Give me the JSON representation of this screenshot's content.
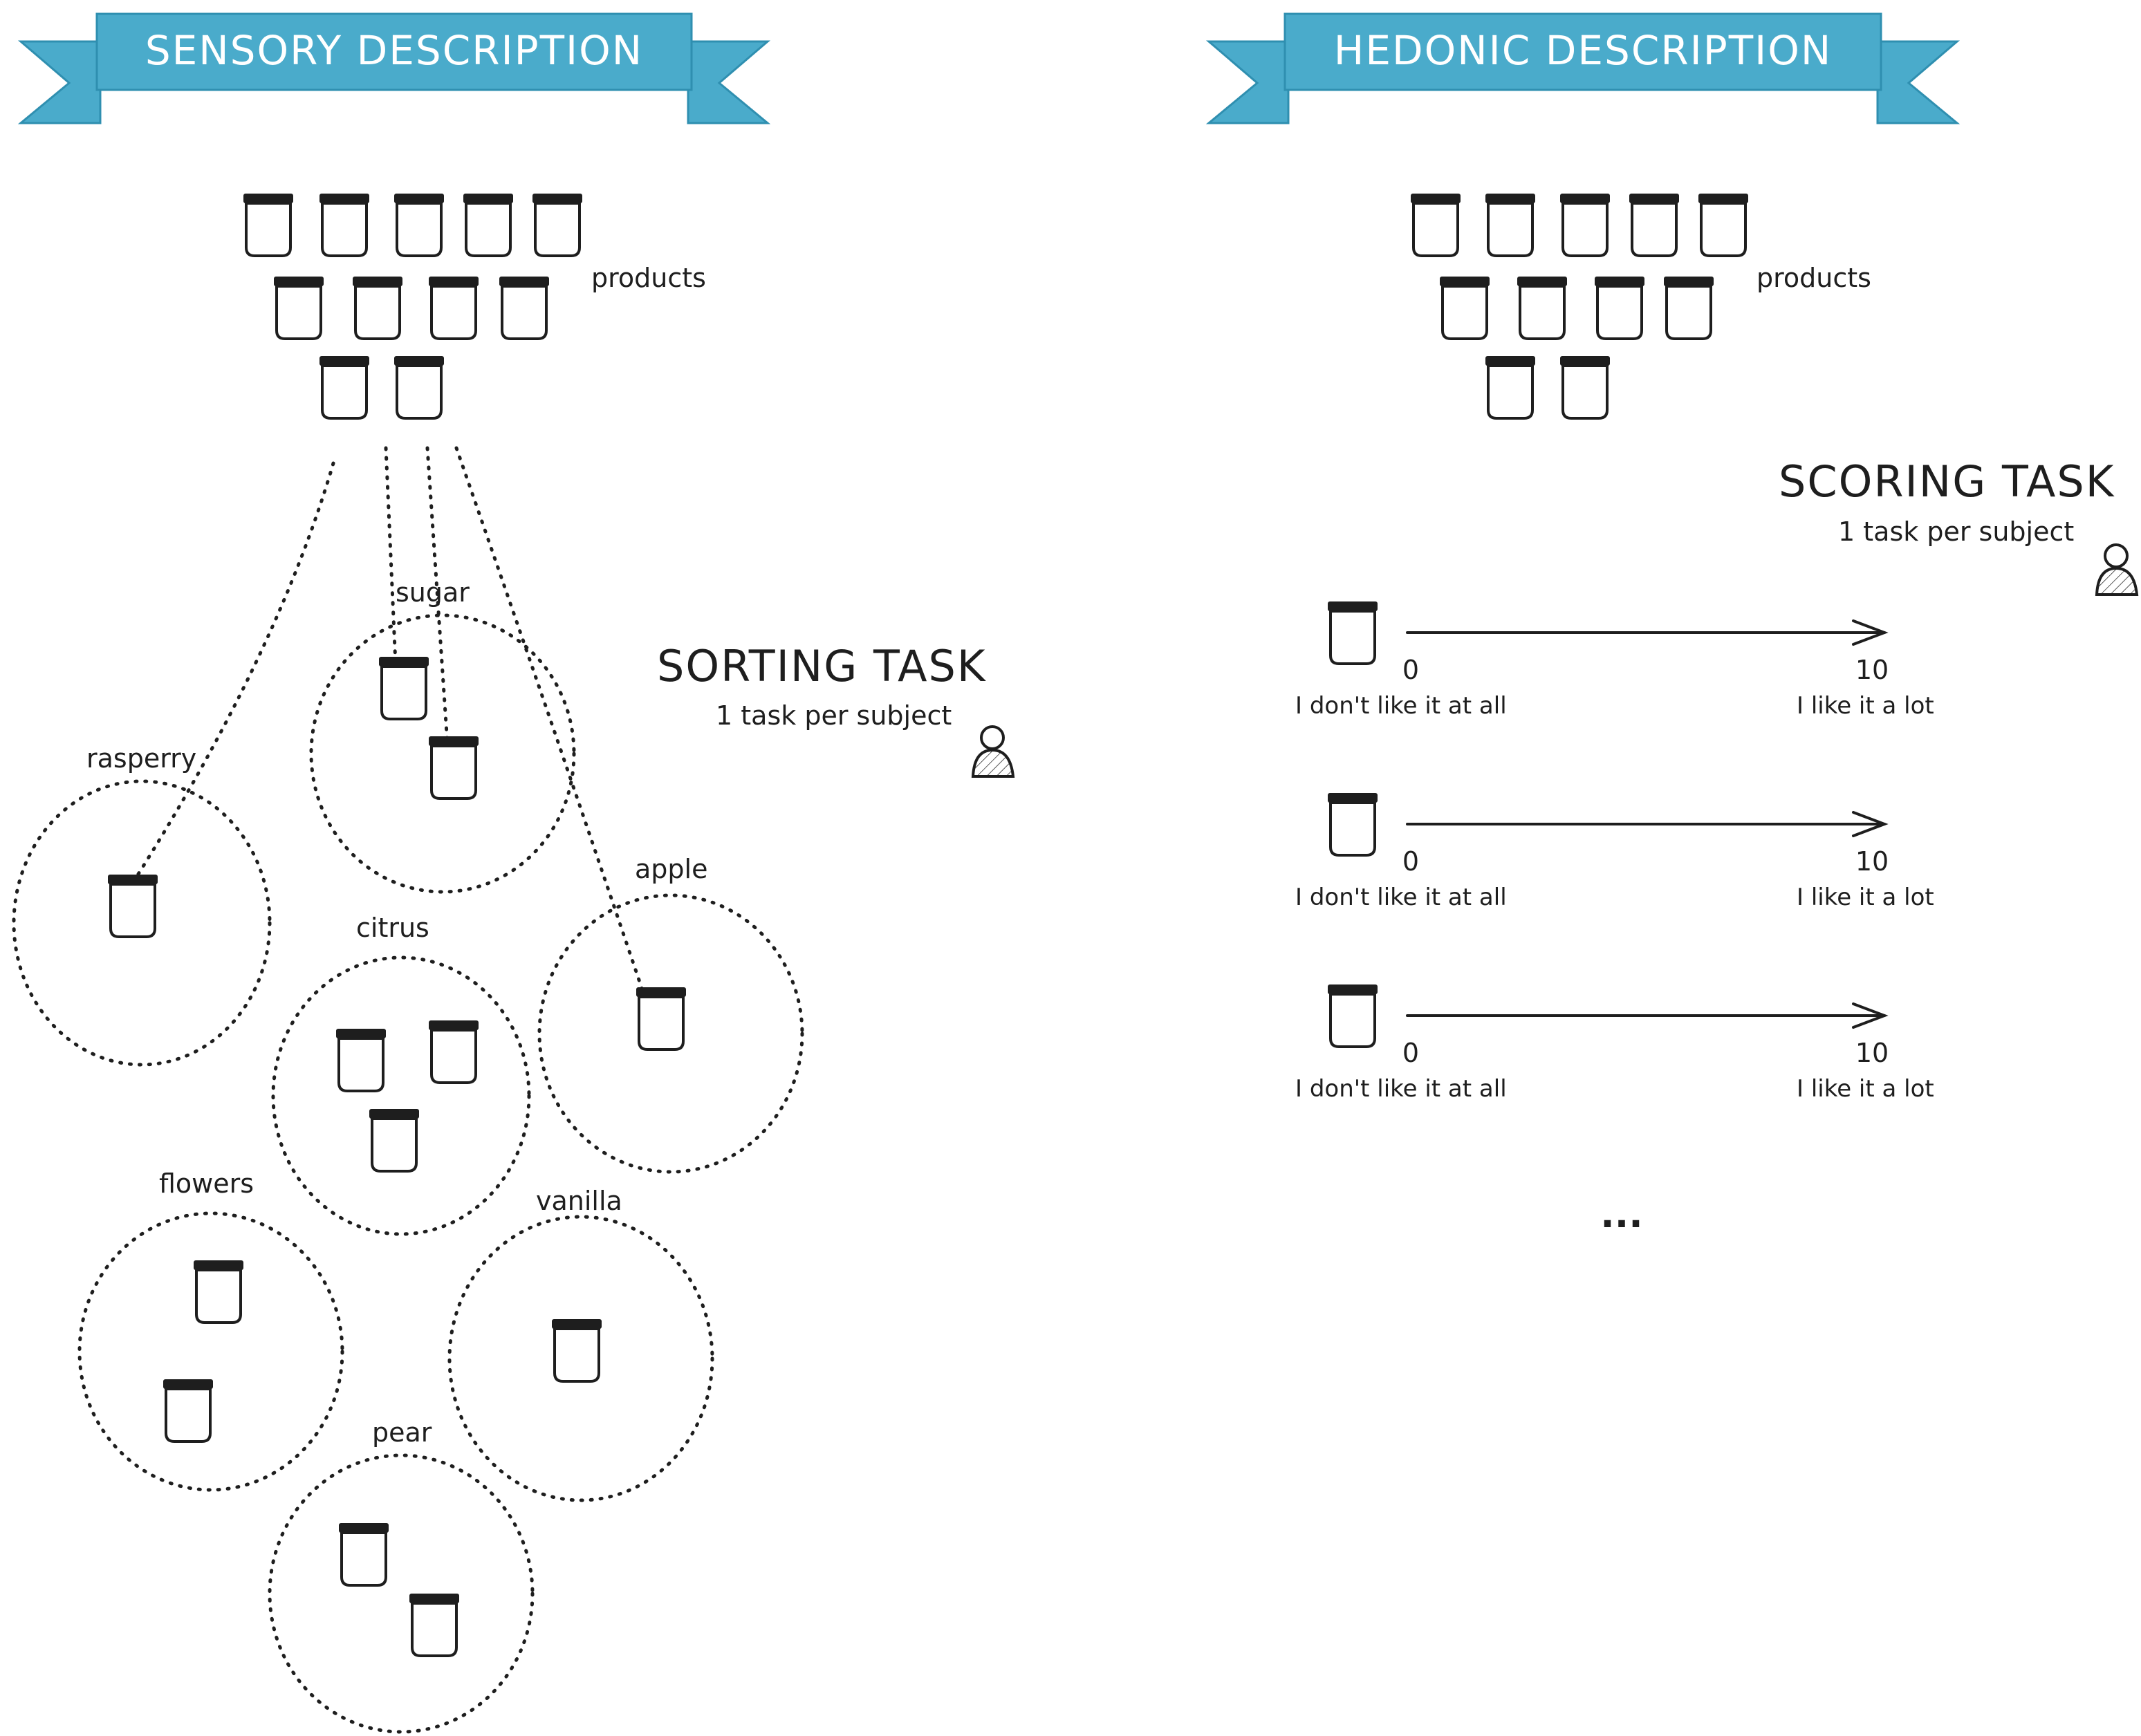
{
  "left_panel": {
    "banner": "SENSORY DESCRIPTION",
    "products_label": "products",
    "task_title": "SORTING TASK",
    "task_subtitle": "1 task per subject",
    "clusters": [
      "sugar",
      "rasperry",
      "apple",
      "citrus",
      "flowers",
      "vanilla",
      "pear"
    ]
  },
  "right_panel": {
    "banner": "HEDONIC DESCRIPTION",
    "products_label": "products",
    "task_title": "SCORING TASK",
    "task_subtitle": "1 task per subject",
    "scales": [
      {
        "min": "0",
        "max": "10",
        "min_label": "I don't like it at all",
        "max_label": "I like it a lot"
      },
      {
        "min": "0",
        "max": "10",
        "min_label": "I don't like it at all",
        "max_label": "I like it a lot"
      },
      {
        "min": "0",
        "max": "10",
        "min_label": "I don't like it at all",
        "max_label": "I like it a lot"
      }
    ],
    "ellipsis": "..."
  },
  "colors": {
    "banner": "#4aabcb",
    "banner_dark": "#2f8fb0",
    "ink": "#1e1e1e"
  },
  "icons": [
    "jar-icon",
    "person-icon",
    "arrow-icon"
  ]
}
